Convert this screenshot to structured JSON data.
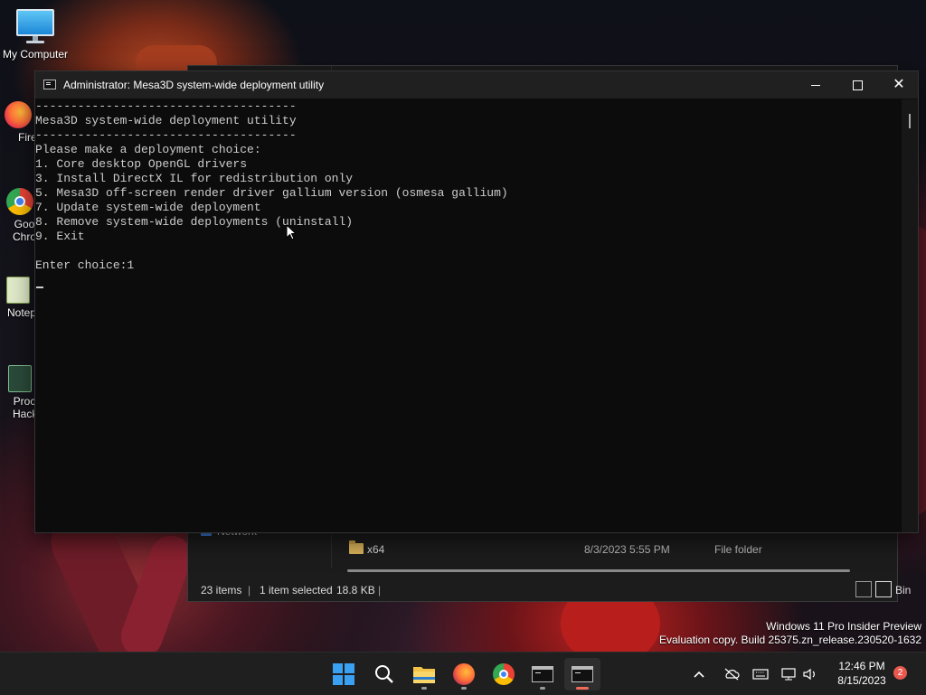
{
  "desktop": {
    "icons": [
      {
        "label": "My Computer",
        "icon": "monitor-icon"
      },
      {
        "label": "Fire",
        "icon": "firefox-icon"
      },
      {
        "label": "Goo Chro",
        "icon": "chrome-icon"
      },
      {
        "label": "Notep",
        "icon": "notepad-icon"
      },
      {
        "label": "Proc Hack",
        "icon": "process-hacker-icon"
      }
    ]
  },
  "explorer": {
    "network_label": "Network",
    "row": {
      "name": "x64",
      "date": "8/3/2023 5:55 PM",
      "type": "File folder"
    },
    "status": {
      "items": "23 items",
      "selected": "1 item selected",
      "size": "18.8 KB",
      "trailing": "Bin"
    }
  },
  "console": {
    "title": "Administrator:  Mesa3D system-wide deployment utility",
    "lines": [
      "-------------------------------------",
      "Mesa3D system-wide deployment utility",
      "-------------------------------------",
      "Please make a deployment choice:",
      "1. Core desktop OpenGL drivers",
      "3. Install DirectX IL for redistribution only",
      "5. Mesa3D off-screen render driver gallium version (osmesa gallium)",
      "7. Update system-wide deployment",
      "8. Remove system-wide deployments (uninstall)",
      "9. Exit",
      "",
      "Enter choice:1"
    ]
  },
  "watermark": {
    "line1": "Windows 11 Pro Insider Preview",
    "line2": "Evaluation copy. Build 25375.zn_release.230520-1632"
  },
  "taskbar": {
    "apps": [
      "start-icon",
      "search-icon",
      "file-explorer-icon",
      "firefox-icon",
      "chrome-icon",
      "terminal-icon",
      "terminal-icon"
    ],
    "tray_icons": [
      "chevron-up-icon",
      "onedrive-off-icon",
      "keyboard-icon",
      "network-icon",
      "volume-icon"
    ],
    "time": "12:46 PM",
    "date": "8/15/2023",
    "notification_count": "2"
  },
  "colors": {
    "console_bg": "#0c0c0c",
    "console_text": "#cccccc",
    "titlebar": "#202020",
    "taskbar": "#1f1f1f",
    "accent": "#ef6b5a"
  }
}
